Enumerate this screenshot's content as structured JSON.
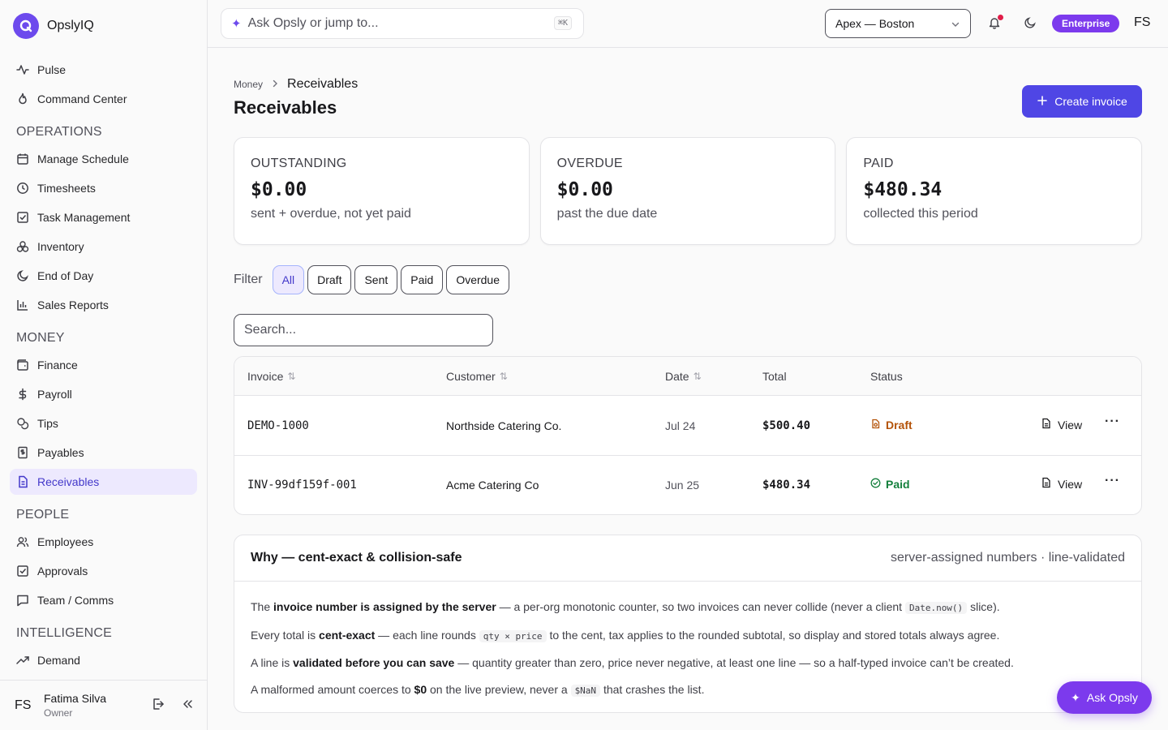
{
  "brand": {
    "name": "OpslyIQ"
  },
  "sidebar": {
    "top_items": [
      {
        "label": "Pulse",
        "icon": "activity-icon"
      },
      {
        "label": "Command Center",
        "icon": "flame-icon"
      }
    ],
    "sections": [
      {
        "title": "OPERATIONS",
        "items": [
          {
            "label": "Manage Schedule",
            "icon": "calendar-icon"
          },
          {
            "label": "Timesheets",
            "icon": "clock-icon"
          },
          {
            "label": "Task Management",
            "icon": "checkbox-icon"
          },
          {
            "label": "Inventory",
            "icon": "boxes-icon"
          },
          {
            "label": "End of Day",
            "icon": "moon-icon"
          },
          {
            "label": "Sales Reports",
            "icon": "bar-chart-icon"
          }
        ]
      },
      {
        "title": "MONEY",
        "items": [
          {
            "label": "Finance",
            "icon": "wallet-icon"
          },
          {
            "label": "Payroll",
            "icon": "dollar-icon"
          },
          {
            "label": "Tips",
            "icon": "coins-icon"
          },
          {
            "label": "Payables",
            "icon": "receipt-icon"
          },
          {
            "label": "Receivables",
            "icon": "document-icon",
            "active": true
          }
        ]
      },
      {
        "title": "PEOPLE",
        "items": [
          {
            "label": "Employees",
            "icon": "users-icon"
          },
          {
            "label": "Approvals",
            "icon": "checkbox-icon"
          },
          {
            "label": "Team / Comms",
            "icon": "chat-icon"
          }
        ]
      },
      {
        "title": "INTELLIGENCE",
        "items": [
          {
            "label": "Demand",
            "icon": "trend-icon"
          }
        ]
      }
    ]
  },
  "user": {
    "initials": "FS",
    "name": "Fatima Silva",
    "role": "Owner"
  },
  "topbar": {
    "command_placeholder": "Ask Opsly or jump to...",
    "shortcut": "⌘K",
    "location": "Apex — Boston",
    "plan": "Enterprise",
    "initials": "FS"
  },
  "page": {
    "breadcrumb_root": "Money",
    "breadcrumb_current": "Receivables",
    "title": "Receivables",
    "create_button": "Create invoice"
  },
  "stats": [
    {
      "label": "OUTSTANDING",
      "value": "$0.00",
      "sub": "sent + overdue, not yet paid"
    },
    {
      "label": "OVERDUE",
      "value": "$0.00",
      "sub": "past the due date"
    },
    {
      "label": "PAID",
      "value": "$480.34",
      "sub": "collected this period"
    }
  ],
  "filter": {
    "label": "Filter",
    "options": [
      "All",
      "Draft",
      "Sent",
      "Paid",
      "Overdue"
    ],
    "active": "All"
  },
  "search": {
    "placeholder": "Search..."
  },
  "table": {
    "headers": {
      "invoice": "Invoice",
      "customer": "Customer",
      "date": "Date",
      "total": "Total",
      "status": "Status"
    },
    "view_label": "View",
    "rows": [
      {
        "invoice": "DEMO-1000",
        "customer": "Northside Catering Co.",
        "date": "Jul 24",
        "total": "$500.40",
        "status": "Draft"
      },
      {
        "invoice": "INV-99df159f-001",
        "customer": "Acme Catering Co",
        "date": "Jun 25",
        "total": "$480.34",
        "status": "Paid"
      }
    ]
  },
  "why": {
    "title": "Why — cent-exact & collision-safe",
    "meta": "server-assigned numbers · line-validated",
    "lines": [
      {
        "pre": "The ",
        "bold": "invoice number is assigned by the server",
        "mid": " — a per-org monotonic counter, so two invoices can never collide (never a client ",
        "code": "Date.now()",
        "post": " slice)."
      },
      {
        "pre": "Every total is ",
        "bold": "cent-exact",
        "mid": " — each line rounds ",
        "code": "qty × price",
        "post": " to the cent, tax applies to the rounded subtotal, so display and stored totals always agree."
      },
      {
        "pre": "A line is ",
        "bold": "validated before you can save",
        "mid": " — quantity greater than zero, price never negative, at least one line — so a half-typed invoice can’t be created.",
        "code": "",
        "post": ""
      },
      {
        "pre": "A malformed amount coerces to ",
        "bold": "$0",
        "mid": " on the live preview, never a ",
        "code": "$NaN",
        "post": " that crashes the list."
      }
    ]
  },
  "ask_fab": "Ask Opsly",
  "colors": {
    "accent": "#4f46e5",
    "brand": "#7c3aed",
    "draft": "#b45309",
    "paid": "#15803d"
  }
}
